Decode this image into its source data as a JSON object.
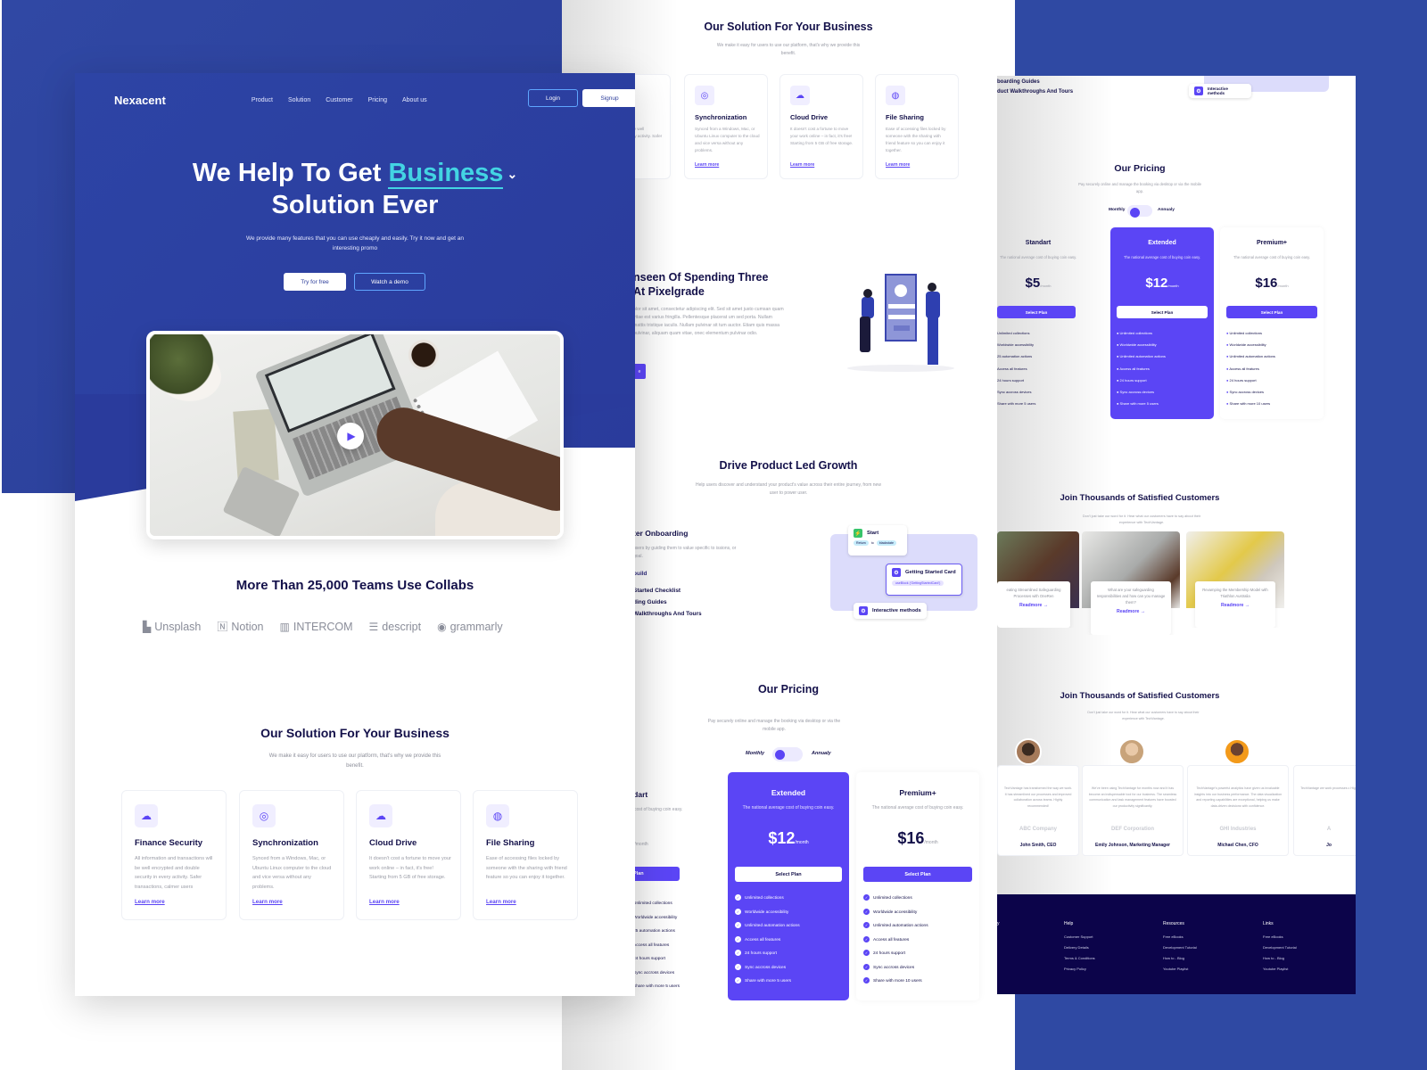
{
  "colors": {
    "brand_blue": "#2d44a5",
    "accent_teal": "#43d4e3",
    "accent_purple": "#5b45f5",
    "navy_text": "#14114a",
    "footer_navy": "#0c044a"
  },
  "header": {
    "logo": "Nexacent",
    "nav": [
      "Product",
      "Solution",
      "Customer",
      "Pricing",
      "About us"
    ],
    "login_label": "Login",
    "signup_label": "Signup"
  },
  "hero": {
    "title_part1": "We Help To Get",
    "title_accent": "Business",
    "title_part2": "Solution Ever",
    "subtitle": "We provide many features that you can use cheaply and easily. Try it now and get an interesting promo",
    "try_label": "Try for free",
    "demo_label": "Watch a demo",
    "play_icon": "play-icon"
  },
  "teams": {
    "title": "More Than 25,000 Teams Use Collabs",
    "logos": [
      {
        "icon": "unsplash-logo",
        "glyph": "▙",
        "name": "Unsplash"
      },
      {
        "icon": "notion-logo",
        "glyph": "🄽",
        "name": "Notion"
      },
      {
        "icon": "intercom-logo",
        "glyph": "▥",
        "name": "INTERCOM"
      },
      {
        "icon": "descript-logo",
        "glyph": "☰",
        "name": "descript"
      },
      {
        "icon": "grammarly-logo",
        "glyph": "◉",
        "name": "grammarly"
      }
    ]
  },
  "solution": {
    "title": "Our Solution For Your Business",
    "subtitle": "We make it easy for users to use our platform, that's why we provide this benefit.",
    "cards": [
      {
        "icon": "cloud-lock-icon",
        "glyph": "☁",
        "title": "Finance Security",
        "desc": "All information and transactions will be well encrypted and double security in every activity. Safer transactions, calmer users",
        "link": "Learn more"
      },
      {
        "icon": "sync-icon",
        "glyph": "◎",
        "title": "Synchronization",
        "desc": "Synced from a Windows, Mac, or Ubuntu Linux computer to the cloud and vice versa without any problems.",
        "link": "Learn more"
      },
      {
        "icon": "cloud-icon",
        "glyph": "☁",
        "title": "Cloud Drive",
        "desc": "It doesn't cost a fortune to move your work online – in fact, it's free! Starting from 5 GB of free storage.",
        "link": "Learn more"
      },
      {
        "icon": "lifebuoy-icon",
        "glyph": "◍",
        "title": "File Sharing",
        "desc": "Ease of accessing files locked by someone with the sharing with friend feature so you can enjoy it together.",
        "link": "Learn more"
      }
    ]
  },
  "pixelgrade": {
    "title_line1": "nseen Of Spending Three",
    "title_line2": "At Pixelgrade",
    "body": "olor sit amet, consectetur adipiscing elit. Sed sit amet justo cumsan quam vitae est varius fringilla. Pellentesque placerat um sed porta. Nullam mattis tristique iaculis. Nullam pulvinar sit tum auctor. Etiam quis massa pulvinar, aliquam quam vitae, onec elementum pulvinar odio.",
    "button_label": "e"
  },
  "growth": {
    "title": "Drive Product Led Growth",
    "subtitle": "Help users discover and understand your product's value across their entire journey, from new user to power user.",
    "left_heading": "ter Onboarding",
    "left_desc": "users by guiding them to value specific to issions, or goal.",
    "build_label": "build",
    "items": [
      "Started Checklist",
      "ding Guides",
      "Walkthroughs And Tours"
    ],
    "flow": {
      "start": "Start",
      "chip_from": "Return",
      "chip_to_word": "to",
      "chip_to": "blackstate",
      "card": "Getting Started Card",
      "card_code": "useBlock ('GettingStartedCard')",
      "interactive": "Interactive methods"
    }
  },
  "pricing": {
    "title": "Our Pricing",
    "subtitle": "Pay securely online and manage the booking via desktop or via the mobile app.",
    "monthly_label": "Monthly",
    "annually_label": "Annualy",
    "billing": "Monthly",
    "plans": [
      {
        "name": "Standart",
        "desc": "The national average cost of buying coin easy.",
        "price": "$5",
        "period": "/month",
        "button": "Select Plan",
        "features": [
          "Unlimited collections",
          "Worldwide accessibility",
          "25 automation actions",
          "Access all features",
          "24 hours support",
          "Sync accross devices",
          "Share with more 5 users"
        ]
      },
      {
        "name": "Extended",
        "desc": "The national average cost of buying coin easy.",
        "price": "$12",
        "period": "/month",
        "button": "Select Plan",
        "features": [
          "Unlimited collections",
          "Worldwide accessibility",
          "Unlimited automation actions",
          "Access all features",
          "24 hours support",
          "Sync accross devices",
          "Share with more 5 users"
        ]
      },
      {
        "name": "Premium+",
        "desc": "The national average cost of buying coin easy.",
        "price": "$16",
        "period": "/month",
        "button": "Select Plan",
        "features": [
          "Unlimited collections",
          "Worldwide accessibility",
          "Unlimited automation actions",
          "Access all features",
          "24 hours support",
          "Sync accross devices",
          "Share with more 10 users"
        ]
      }
    ]
  },
  "right": {
    "top_items": [
      "boarding Guides",
      "duct Walkthroughs And Tours"
    ],
    "interactive": "Interactive methods",
    "blog": {
      "title": "Join Thousands of Satisfied Customers",
      "subtitle": "Don't just take our word for it. Hear what our customers have to say about their experience with TechVantage.",
      "posts": [
        {
          "text": "eating Streamlined Safeguarding Processes with OneRen",
          "link": "Readmore →"
        },
        {
          "text": "What are your safeguarding responsibilities and how can you manage them?",
          "link": "Readmore →"
        },
        {
          "text": "Revamping the Membership Model with Triathlon Australia",
          "link": "Readmore →"
        }
      ]
    },
    "testimonials": {
      "title": "Join Thousands of Satisfied Customers",
      "subtitle": "Don't just take our word for it. Hear what our customers have to say about their experience with TechVantage.",
      "items": [
        {
          "quote": "TechVantage has transformed the way we work. It has streamlined our processes and improved collaboration across teams. Highly recommended!",
          "company": "ABC Company",
          "name": "John Smith, CEO"
        },
        {
          "quote": "We've been using TechVantage for months now and it has become an indispensable tool for our business. The seamless communication and task management features have boosted our productivity significantly.",
          "company": "DEF Corporation",
          "name": "Emily Johnson, Marketing Manager"
        },
        {
          "quote": "TechVantage's powerful analytics have given us invaluable insights into our business performance. The data visualization and reporting capabilities are exceptional, helping us make data-driven decisions with confidence.",
          "company": "GHI Industries",
          "name": "Michael Chen, CFO"
        },
        {
          "quote": "TechVantage we work processes c High",
          "company": "A",
          "name": "Jo"
        }
      ]
    },
    "footer": {
      "cols": [
        {
          "head": "y",
          "links": []
        },
        {
          "head": "Help",
          "links": [
            "Customer Support",
            "Delivery Details",
            "Terms & Conditions",
            "Privacy Policy"
          ]
        },
        {
          "head": "Resources",
          "links": [
            "Free eBooks",
            "Development Tutorial",
            "How to - Blog",
            "Youtube Playlist"
          ]
        },
        {
          "head": "Links",
          "links": [
            "Free eBooks",
            "Development Tutorial",
            "How to - Blog",
            "Youtube Playlist"
          ]
        }
      ]
    }
  }
}
